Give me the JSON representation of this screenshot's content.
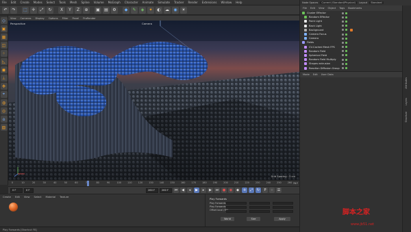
{
  "menubar": [
    "File",
    "Edit",
    "Create",
    "Modes",
    "Select",
    "Tools",
    "Mesh",
    "Spline",
    "Volume",
    "MoGraph",
    "Character",
    "Animate",
    "Simulate",
    "Tracker",
    "Render",
    "Extensions",
    "Window",
    "Help"
  ],
  "viewport": {
    "menu": [
      "View",
      "Cameras",
      "Display",
      "Options",
      "Filter",
      "Panel",
      "ProRender"
    ],
    "label": "Perspective",
    "camera": "Camera",
    "grid_info": "Grid Spacing : 5 cm"
  },
  "timeline": {
    "ticks": [
      "0",
      "10",
      "20",
      "30",
      "40",
      "50",
      "60",
      "70",
      "80",
      "90",
      "100",
      "110",
      "120",
      "130",
      "140",
      "150",
      "160",
      "170",
      "180",
      "190",
      "200",
      "210",
      "220",
      "230",
      "240",
      "250",
      "260"
    ],
    "playhead_frame": 70,
    "max_frame": 260,
    "frame_label": "76 F"
  },
  "transport": {
    "start": "0 F",
    "current": "0 F",
    "end": "260 F",
    "max": "260 F"
  },
  "material_manager": {
    "menu": [
      "Create",
      "Edit",
      "View",
      "Select",
      "Material",
      "Texture"
    ]
  },
  "attributes": {
    "title": "Play Forwards",
    "rows": [
      "Play Forwards",
      "Play Forwards",
      "Offset local (Fill)"
    ],
    "buttons": [
      "World",
      "Size",
      "Apply"
    ]
  },
  "status": "Play Forwards [Shortcut F8]",
  "right_top": [
    "Node Spaces",
    "Current (Standard/Physical)",
    "Layout",
    "Standard"
  ],
  "object_manager": {
    "menu": [
      "File",
      "Edit",
      "View",
      "Object",
      "Tags",
      "Bookmarks"
    ],
    "items": [
      {
        "label": "Cluster Effector",
        "color": "#6cc25a"
      },
      {
        "label": "Random Effector",
        "color": "#6cc25a"
      },
      {
        "label": "Point Light",
        "color": "#e8e8e8"
      },
      {
        "label": "Back Light",
        "color": "#e8e8e8"
      },
      {
        "label": "Background",
        "color": "#b0b0b0",
        "tag": "#e07a2a"
      },
      {
        "label": "Camera Focus",
        "color": "#7fb3ff"
      },
      {
        "label": "Camera",
        "color": "#7fb3ff"
      },
      {
        "label": "Fields",
        "color": "#9a9aff"
      },
      {
        "label": "CV-Cached Mesh FPS",
        "color": "#c28cff"
      },
      {
        "label": "Random Field",
        "color": "#c28cff"
      },
      {
        "label": "Spherical Field",
        "color": "#c28cff"
      },
      {
        "label": "Random Field Multiply",
        "color": "#c28cff"
      },
      {
        "label": "Shapes extrusion",
        "color": "#c28cff"
      },
      {
        "label": "Reaction Diffusion Group",
        "color": "#c28cff"
      }
    ]
  },
  "attribute_manager": {
    "menu": [
      "Mode",
      "Edit",
      "User Data"
    ]
  },
  "right_tabs": [
    "Attributes",
    "Layers",
    "Structure"
  ],
  "watermark": {
    "main": "脚本之家",
    "sub": "www.jb51.net"
  },
  "colors": {
    "accent": "#f0a020",
    "selection": "#5a78b8",
    "panel": "#313131"
  }
}
